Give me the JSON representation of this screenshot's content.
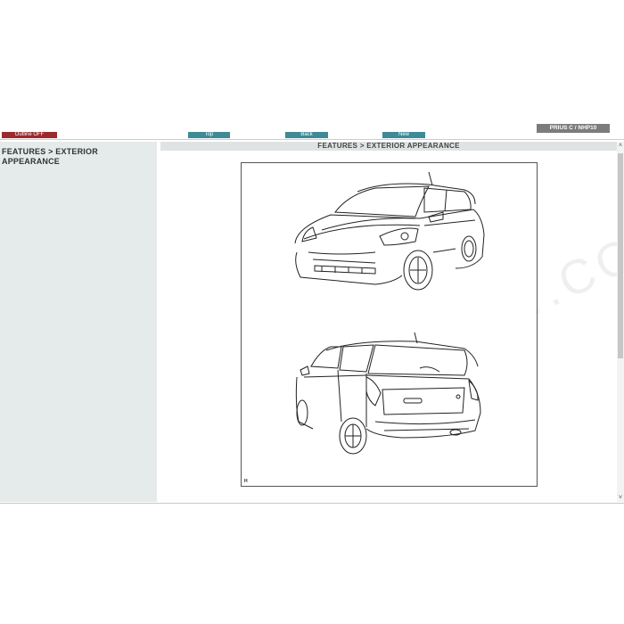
{
  "toolbar": {
    "outline_label": "Outline OFF",
    "top_label": "Top",
    "back_label": "Back",
    "new_label": "New",
    "model_label": "PRIUS C / NHP10",
    "colors": {
      "outline": "#9b2a2d",
      "nav": "#3e8a96",
      "model": "#7c7c7c"
    }
  },
  "sidebar": {
    "title": "FEATURES > EXTERIOR APPEARANCE"
  },
  "content": {
    "header": "FEATURES > EXTERIOR APPEARANCE",
    "figure": {
      "id_label": "H",
      "watermark": "EPCDEPOT.COM",
      "front_view_icon": "car-front-three-quarter-line-drawing",
      "rear_view_icon": "car-rear-three-quarter-line-drawing"
    }
  },
  "scrollbar": {
    "up_icon": "chevron-up-icon",
    "down_icon": "chevron-down-icon"
  }
}
